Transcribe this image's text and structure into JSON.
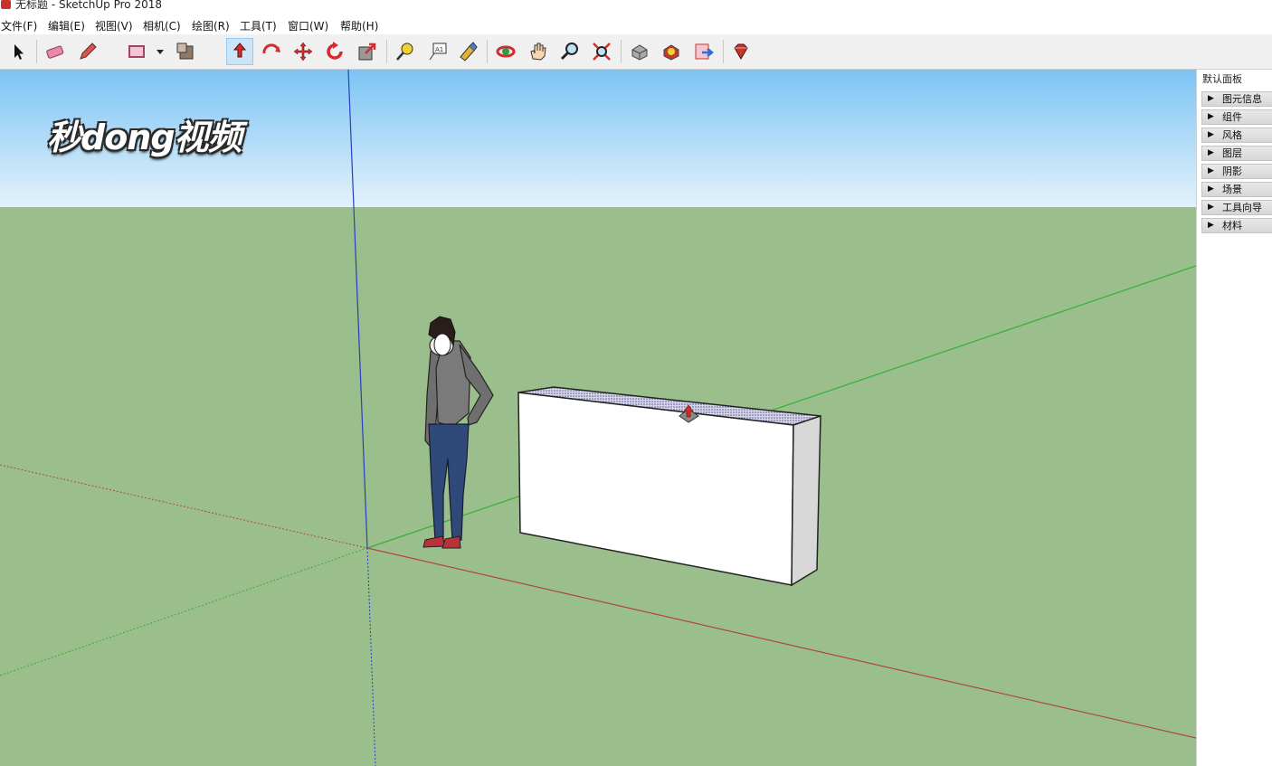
{
  "window": {
    "title": "无标题 - SketchUp Pro 2018"
  },
  "menu": [
    "文件(F)",
    "编辑(E)",
    "视图(V)",
    "相机(C)",
    "绘图(R)",
    "工具(T)",
    "窗口(W)",
    "帮助(H)"
  ],
  "toolbar": {
    "tools": [
      "select",
      "eraser",
      "pencil",
      "rectangle",
      "paint-bucket",
      "push-pull",
      "follow-me",
      "move",
      "rotate",
      "scale",
      "tape-measure",
      "text",
      "paint",
      "orbit",
      "pan",
      "zoom",
      "zoom-extents",
      "3d-warehouse",
      "extension-warehouse",
      "share-model",
      "ruby-console"
    ],
    "active_tool": "push-pull"
  },
  "watermark": {
    "text": "秒dong视频"
  },
  "tray": {
    "title": "默认面板",
    "panels": [
      "图元信息",
      "组件",
      "风格",
      "图层",
      "阴影",
      "场景",
      "工具向导",
      "材料"
    ]
  },
  "colors": {
    "sky_top": "#7cc4f5",
    "sky_bottom": "#e4f2fb",
    "ground": "#9bbe8d",
    "axis_red": "#b0483a",
    "axis_green": "#34b034",
    "axis_blue": "#2a3fbf"
  }
}
